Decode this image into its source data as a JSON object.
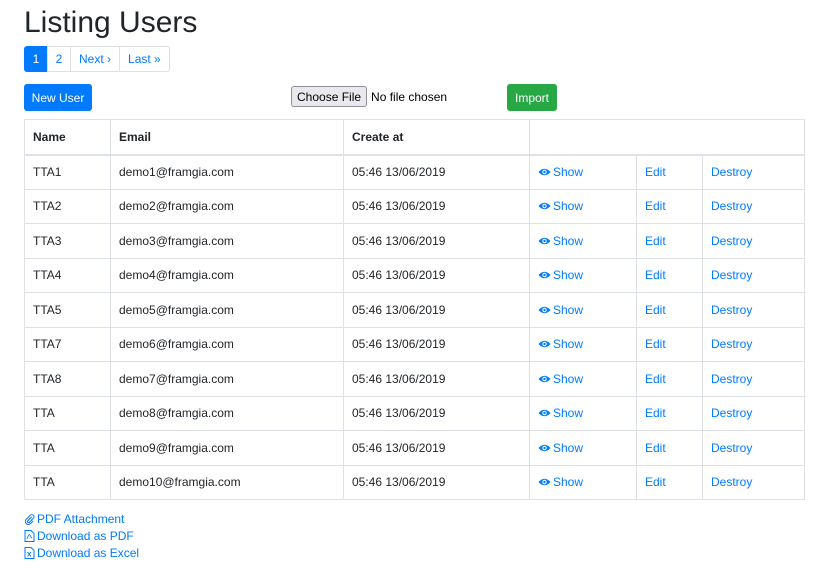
{
  "page": {
    "title": "Listing Users"
  },
  "pagination": {
    "pages": [
      "1",
      "2"
    ],
    "next": "Next ›",
    "last": "Last »",
    "active": "1"
  },
  "actions": {
    "new_user": "New User",
    "choose_file": "Choose File",
    "file_status": "No file chosen",
    "import": "Import"
  },
  "table": {
    "headers": {
      "name": "Name",
      "email": "Email",
      "created": "Create at",
      "actions": ""
    },
    "rows": [
      {
        "name": "TTA1",
        "email": "demo1@framgia.com",
        "created": "05:46 13/06/2019"
      },
      {
        "name": "TTA2",
        "email": "demo2@framgia.com",
        "created": "05:46 13/06/2019"
      },
      {
        "name": "TTA3",
        "email": "demo3@framgia.com",
        "created": "05:46 13/06/2019"
      },
      {
        "name": "TTA4",
        "email": "demo4@framgia.com",
        "created": "05:46 13/06/2019"
      },
      {
        "name": "TTA5",
        "email": "demo5@framgia.com",
        "created": "05:46 13/06/2019"
      },
      {
        "name": "TTA7",
        "email": "demo6@framgia.com",
        "created": "05:46 13/06/2019"
      },
      {
        "name": "TTA8",
        "email": "demo7@framgia.com",
        "created": "05:46 13/06/2019"
      },
      {
        "name": "TTA",
        "email": "demo8@framgia.com",
        "created": "05:46 13/06/2019"
      },
      {
        "name": "TTA",
        "email": "demo9@framgia.com",
        "created": "05:46 13/06/2019"
      },
      {
        "name": "TTA",
        "email": "demo10@framgia.com",
        "created": "05:46 13/06/2019"
      }
    ],
    "row_actions": {
      "show": "Show",
      "edit": "Edit",
      "destroy": "Destroy"
    }
  },
  "footer": {
    "pdf_attachment": "PDF Attachment",
    "download_pdf": "Download as PDF",
    "download_excel": "Download as Excel"
  },
  "icons": {
    "show": "eye-icon",
    "attachment": "paperclip-icon",
    "pdf": "file-pdf-icon",
    "excel": "file-excel-icon"
  },
  "colors": {
    "primary": "#007bff",
    "success": "#28a745",
    "border": "#dee2e6"
  }
}
